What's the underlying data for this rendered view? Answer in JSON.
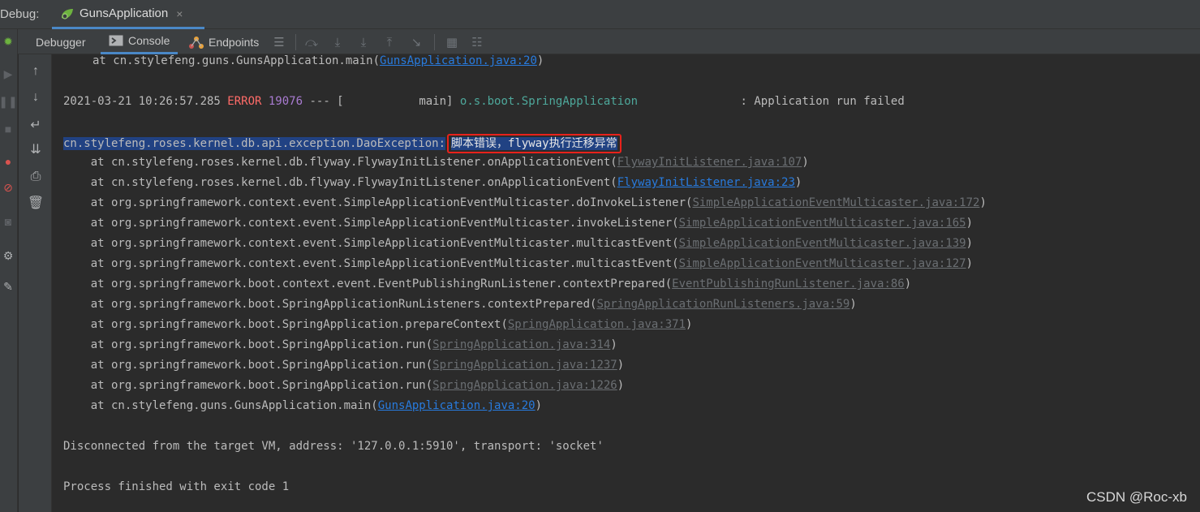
{
  "window": {
    "debug_label": "Debug:",
    "run_tab": "GunsApplication",
    "close_glyph": "×"
  },
  "toolbar": {
    "tabs": [
      {
        "label": "Debugger",
        "icon": ""
      },
      {
        "label": "Console",
        "icon": "console-icon"
      },
      {
        "label": "Endpoints",
        "icon": "endpoints-icon"
      }
    ],
    "buttons": [
      "menu-icon",
      "step-over-icon",
      "step-into-icon",
      "force-step-into-icon",
      "step-out-icon",
      "run-to-cursor-icon",
      "evaluate-icon",
      "trace-icon"
    ]
  },
  "console": {
    "top_at_prefix": "at cn.stylefeng.guns.GunsApplication.main(",
    "top_at_link": "GunsApplication.java:20",
    "top_at_suffix": ")",
    "log_time": "2021-03-21 10:26:57.285 ",
    "log_level": "ERROR",
    "log_pid": " 19076",
    "log_sep": " --- [           main] ",
    "log_logger": "o.s.boot.SpringApplication",
    "log_msg": "               : Application run failed",
    "exception_a": "cn.stylefeng.roses.kernel.db.api.exceptio",
    "exception_b": "n.DaoException:",
    "exception_msg": "脚本错误，flyway执行迁移异常",
    "stack": [
      {
        "prefix": "    at cn.stylefeng.roses.kernel.db.flyway.FlywayInitListener.onApplicationEvent(",
        "link": "FlywayInitListener.java:107",
        "style": "gray"
      },
      {
        "prefix": "    at cn.stylefeng.roses.kernel.db.flyway.FlywayInitListener.onApplicationEvent(",
        "link": "FlywayInitListener.java:23",
        "style": "blue"
      },
      {
        "prefix": "    at org.springframework.context.event.SimpleApplicationEventMulticaster.doInvokeListener(",
        "link": "SimpleApplicationEventMulticaster.java:172",
        "style": "gray"
      },
      {
        "prefix": "    at org.springframework.context.event.SimpleApplicationEventMulticaster.invokeListener(",
        "link": "SimpleApplicationEventMulticaster.java:165",
        "style": "gray"
      },
      {
        "prefix": "    at org.springframework.context.event.SimpleApplicationEventMulticaster.multicastEvent(",
        "link": "SimpleApplicationEventMulticaster.java:139",
        "style": "gray"
      },
      {
        "prefix": "    at org.springframework.context.event.SimpleApplicationEventMulticaster.multicastEvent(",
        "link": "SimpleApplicationEventMulticaster.java:127",
        "style": "gray"
      },
      {
        "prefix": "    at org.springframework.boot.context.event.EventPublishingRunListener.contextPrepared(",
        "link": "EventPublishingRunListener.java:86",
        "style": "gray"
      },
      {
        "prefix": "    at org.springframework.boot.SpringApplicationRunListeners.contextPrepared(",
        "link": "SpringApplicationRunListeners.java:59",
        "style": "gray"
      },
      {
        "prefix": "    at org.springframework.boot.SpringApplication.prepareContext(",
        "link": "SpringApplication.java:371",
        "style": "gray"
      },
      {
        "prefix": "    at org.springframework.boot.SpringApplication.run(",
        "link": "SpringApplication.java:314",
        "style": "gray"
      },
      {
        "prefix": "    at org.springframework.boot.SpringApplication.run(",
        "link": "SpringApplication.java:1237",
        "style": "gray"
      },
      {
        "prefix": "    at org.springframework.boot.SpringApplication.run(",
        "link": "SpringApplication.java:1226",
        "style": "gray"
      },
      {
        "prefix": "    at cn.stylefeng.guns.GunsApplication.main(",
        "link": "GunsApplication.java:20",
        "style": "blue"
      }
    ],
    "disconnected": "Disconnected from the target VM, address: '127.0.0.1:5910', transport: 'socket'",
    "process_finished": "Process finished with exit code 1"
  },
  "watermark": "CSDN @Roc-xb",
  "colors": {
    "error": "#ff6b68",
    "link": "#287bde",
    "selection": "#214283",
    "highlight_box": "#e8221b"
  }
}
